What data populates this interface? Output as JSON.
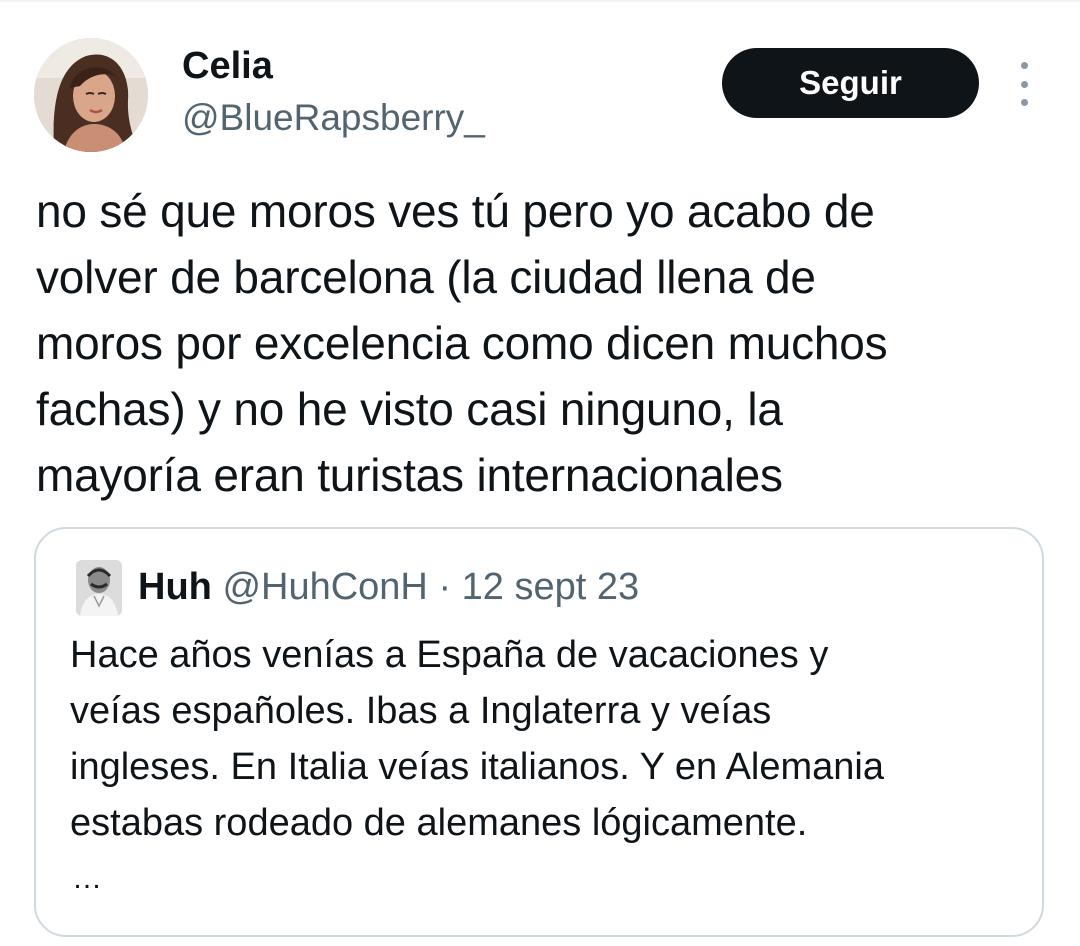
{
  "tweet": {
    "author": {
      "name": "Celia",
      "handle": "@BlueRapsberry_"
    },
    "follow_label": "Seguir",
    "more_icon": "more-vertical-icon",
    "text_lines": [
      "no sé que moros ves tú pero yo acabo de",
      "volver de barcelona (la ciudad llena de",
      "moros por excelencia como dicen muchos",
      "fachas) y no he visto casi ninguno, la",
      "mayoría eran turistas internacionales"
    ]
  },
  "quoted_tweet": {
    "author": {
      "name": "Huh",
      "handle": "@HuhConH"
    },
    "separator": "·",
    "date": "12 sept 23",
    "text_lines": [
      "Hace años venías a España de vacaciones y",
      "veías españoles. Ibas a Inglaterra y veías",
      "ingleses. En Italia veías italianos. Y en Alemania",
      "estabas rodeado de alemanes lógicamente."
    ],
    "ellipsis": "…"
  },
  "colors": {
    "text_primary": "#0f1419",
    "text_secondary": "#536471",
    "border": "#cfd9de",
    "button_bg": "#0f1419",
    "button_text": "#ffffff"
  }
}
